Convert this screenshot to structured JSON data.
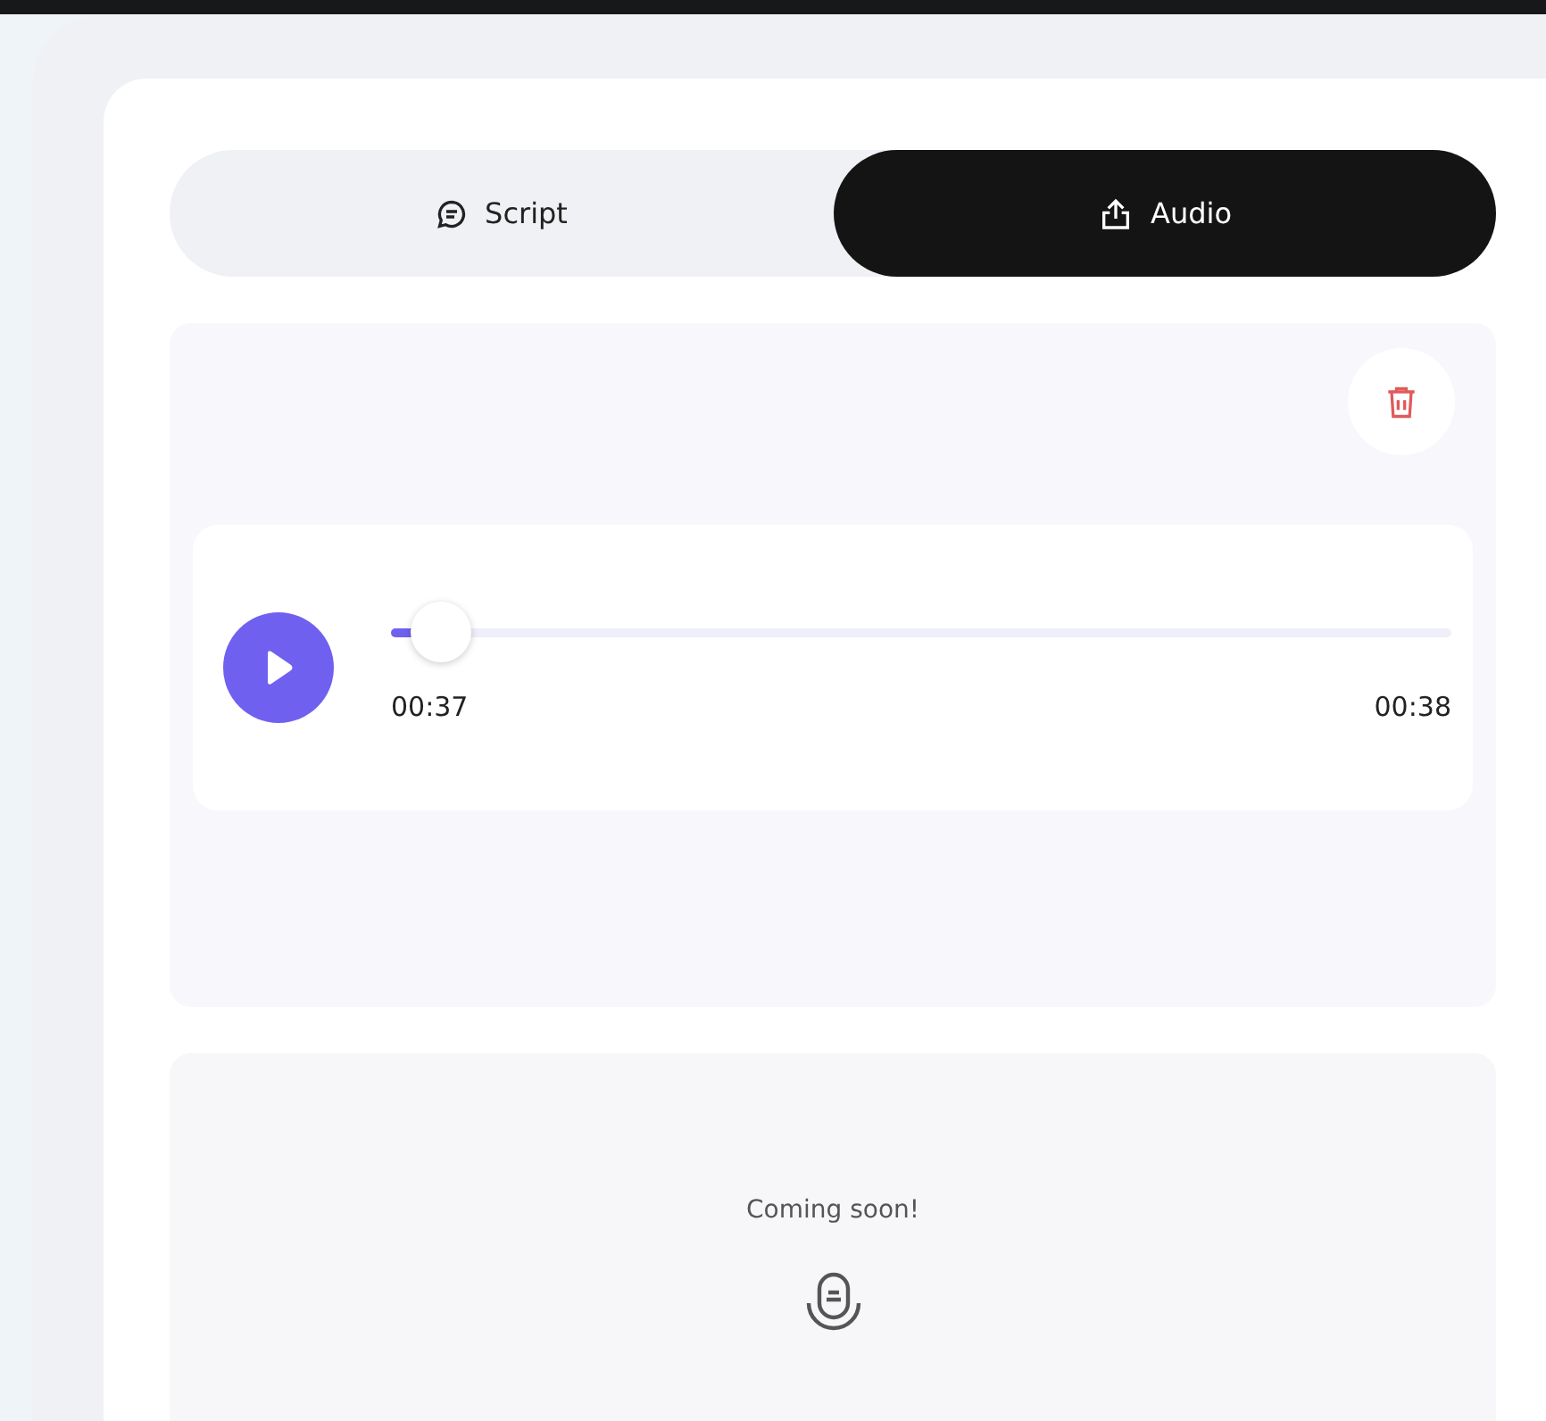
{
  "tabs": [
    {
      "label": "Script",
      "selected": false
    },
    {
      "label": "Audio",
      "selected": true
    }
  ],
  "player": {
    "level": 0.04,
    "current": "00:37",
    "total": "00:38",
    "playing": false
  },
  "coming_soon": {
    "message": "Coming soon!"
  }
}
